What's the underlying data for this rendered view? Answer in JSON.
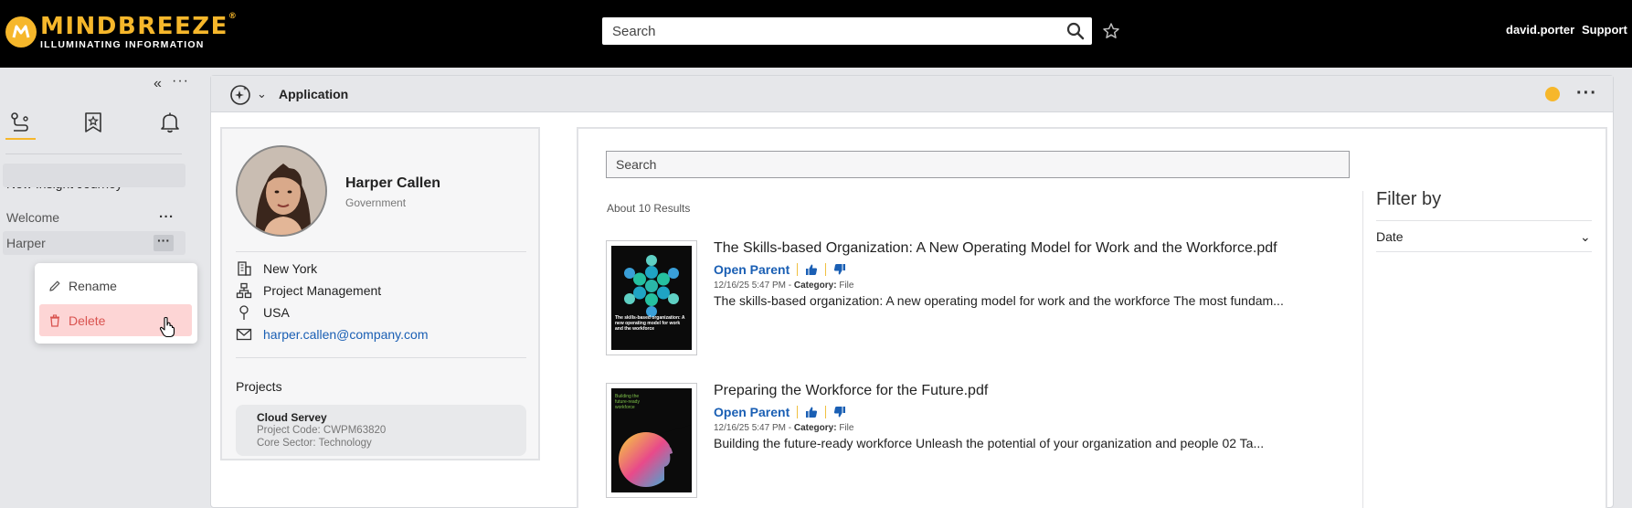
{
  "brand": {
    "name": "MINDBREEZE",
    "registered": "®",
    "tagline": "ILLUMINATING INFORMATION"
  },
  "topbar": {
    "search_placeholder": "Search",
    "user": "david.porter",
    "support": "Support"
  },
  "sidebar": {
    "journey_title": "New Insight Journey",
    "items": [
      {
        "label": "Welcome"
      },
      {
        "label": "Harper"
      }
    ],
    "context_menu": {
      "rename": "Rename",
      "delete": "Delete"
    }
  },
  "app": {
    "title": "Application"
  },
  "profile": {
    "name": "Harper Callen",
    "org": "Government",
    "city": "New York",
    "department": "Project Management",
    "country": "USA",
    "email": "harper.callen@company.com",
    "projects_label": "Projects",
    "project": {
      "title": "Cloud Servey",
      "code_label": "Project Code:",
      "code": "CWPM63820",
      "sector_label": "Core Sector:",
      "sector": "Technology"
    }
  },
  "results": {
    "search_placeholder": "Search",
    "count": "About 10 Results",
    "items": [
      {
        "title": "The Skills-based Organization: A New Operating Model for Work and the Workforce.pdf",
        "open_parent": "Open Parent",
        "date": "12/16/25 5:47 PM",
        "category_label": "Category:",
        "category": "File",
        "snippet": "The skills-based organization: A new operating model for work and the workforce The most fundam...",
        "thumb_text": "The skills-based organization: A new operating model for work and the workforce"
      },
      {
        "title": "Preparing the Workforce for the Future.pdf",
        "open_parent": "Open Parent",
        "date": "12/16/25 5:47 PM",
        "category_label": "Category:",
        "category": "File",
        "snippet": "Building the future-ready workforce Unleash the potential of your organization and people 02 Ta...",
        "thumb_text": "Building the future-ready workforce"
      }
    ],
    "filter": {
      "title": "Filter by",
      "date_label": "Date"
    }
  },
  "colors": {
    "accent": "#f6b72b",
    "link": "#1a5fb4",
    "delete_bg": "#fdd5d5",
    "delete_text": "#d9534f"
  }
}
